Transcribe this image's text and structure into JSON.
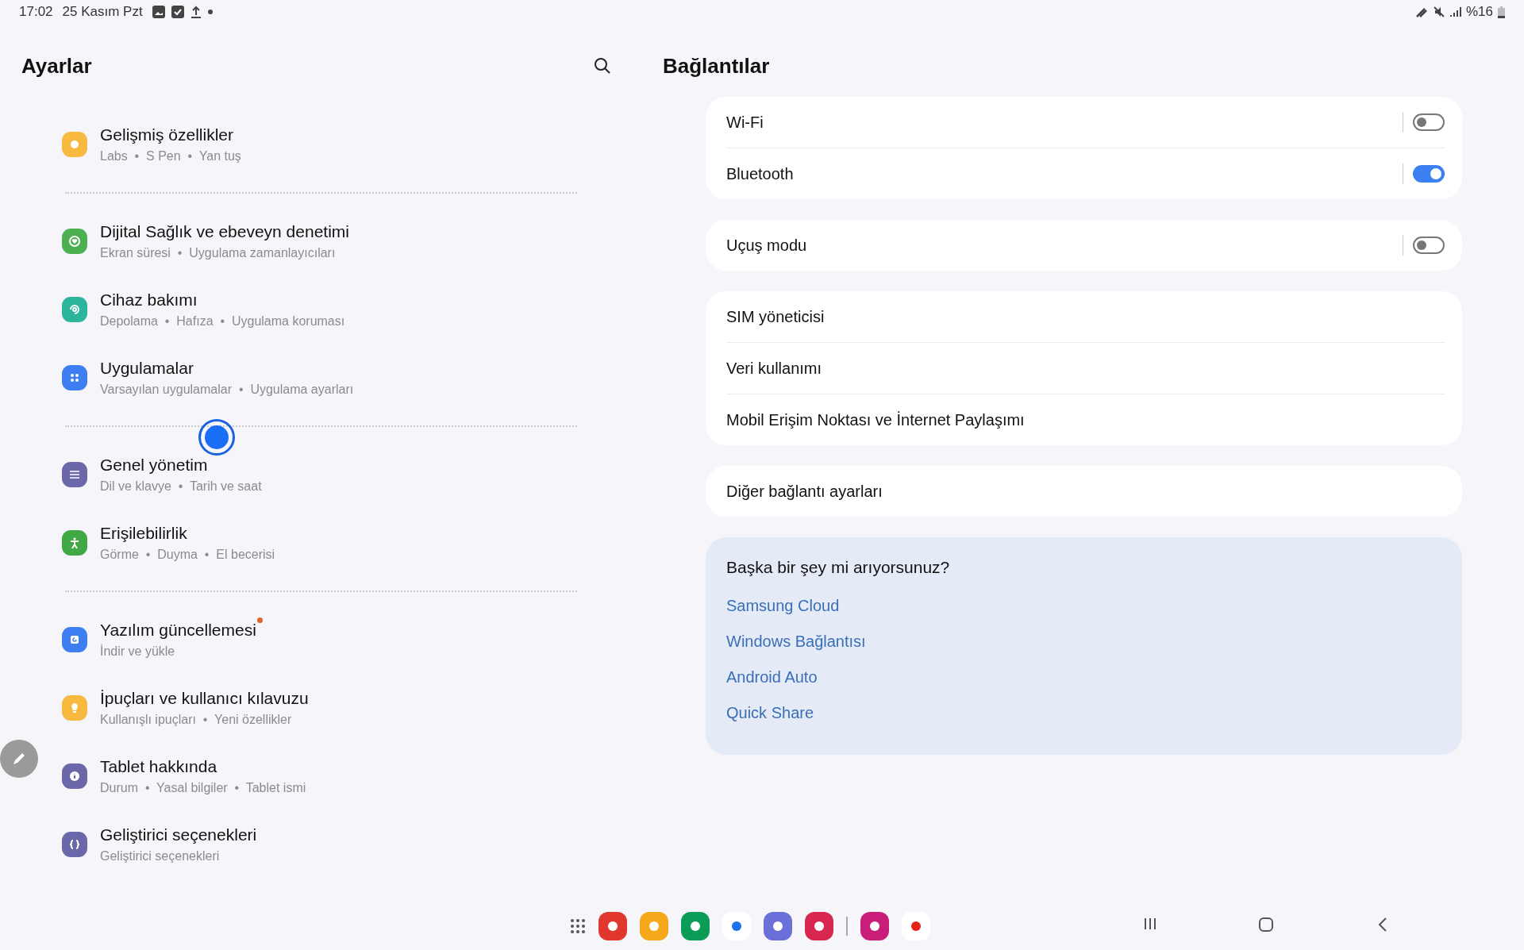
{
  "status_bar": {
    "time": "17:02",
    "date": "25 Kasım Pzt",
    "battery": "%16"
  },
  "settings": {
    "title": "Ayarlar",
    "groups": [
      [
        {
          "title": "Gelişmiş özellikler",
          "subtitle": "Labs  •  S Pen  •  Yan tuş",
          "color": "#f8b940",
          "badge": false
        }
      ],
      [
        {
          "title": "Dijital Sağlık ve ebeveyn denetimi",
          "subtitle": "Ekran süresi  •  Uygulama zamanlayıcıları",
          "color": "#4cb050",
          "badge": false
        },
        {
          "title": "Cihaz bakımı",
          "subtitle": "Depolama  •  Hafıza  •  Uygulama koruması",
          "color": "#2bb59c",
          "badge": false
        },
        {
          "title": "Uygulamalar",
          "subtitle": "Varsayılan uygulamalar  •  Uygulama ayarları",
          "color": "#3d7ef0",
          "badge": false
        }
      ],
      [
        {
          "title": "Genel yönetim",
          "subtitle": "Dil ve klavye  •  Tarih ve saat",
          "color": "#6a68a8",
          "badge": false,
          "touched": true
        },
        {
          "title": "Erişilebilirlik",
          "subtitle": "Görme  •  Duyma  •  El becerisi",
          "color": "#40a845",
          "badge": false
        }
      ],
      [
        {
          "title": "Yazılım güncellemesi",
          "subtitle": "İndir ve yükle",
          "color": "#3d7ef0",
          "badge": true
        },
        {
          "title": "İpuçları ve kullanıcı kılavuzu",
          "subtitle": "Kullanışlı ipuçları  •  Yeni özellikler",
          "color": "#f8b940",
          "badge": false
        },
        {
          "title": "Tablet hakkında",
          "subtitle": "Durum  •  Yasal bilgiler  •  Tablet ismi",
          "color": "#6a68a8",
          "badge": false
        },
        {
          "title": "Geliştirici seçenekleri",
          "subtitle": "Geliştirici seçenekleri",
          "color": "#6a68a8",
          "badge": false
        }
      ]
    ]
  },
  "detail": {
    "title": "Bağlantılar",
    "cards": [
      [
        {
          "kind": "toggle",
          "label": "Wi-Fi",
          "on": false
        },
        {
          "kind": "toggle",
          "label": "Bluetooth",
          "on": true
        }
      ],
      [
        {
          "kind": "toggle",
          "label": "Uçuş modu",
          "on": false
        }
      ],
      [
        {
          "kind": "link",
          "label": "SIM yöneticisi"
        },
        {
          "kind": "link",
          "label": "Veri kullanımı"
        },
        {
          "kind": "link",
          "label": "Mobil Erişim Noktası ve İnternet Paylaşımı"
        }
      ],
      [
        {
          "kind": "link",
          "label": "Diğer bağlantı ayarları"
        }
      ]
    ],
    "suggestions": {
      "title": "Başka bir şey mi arıyorsunuz?",
      "links": [
        "Samsung Cloud",
        "Windows Bağlantısı",
        "Android Auto",
        "Quick Share"
      ]
    }
  }
}
